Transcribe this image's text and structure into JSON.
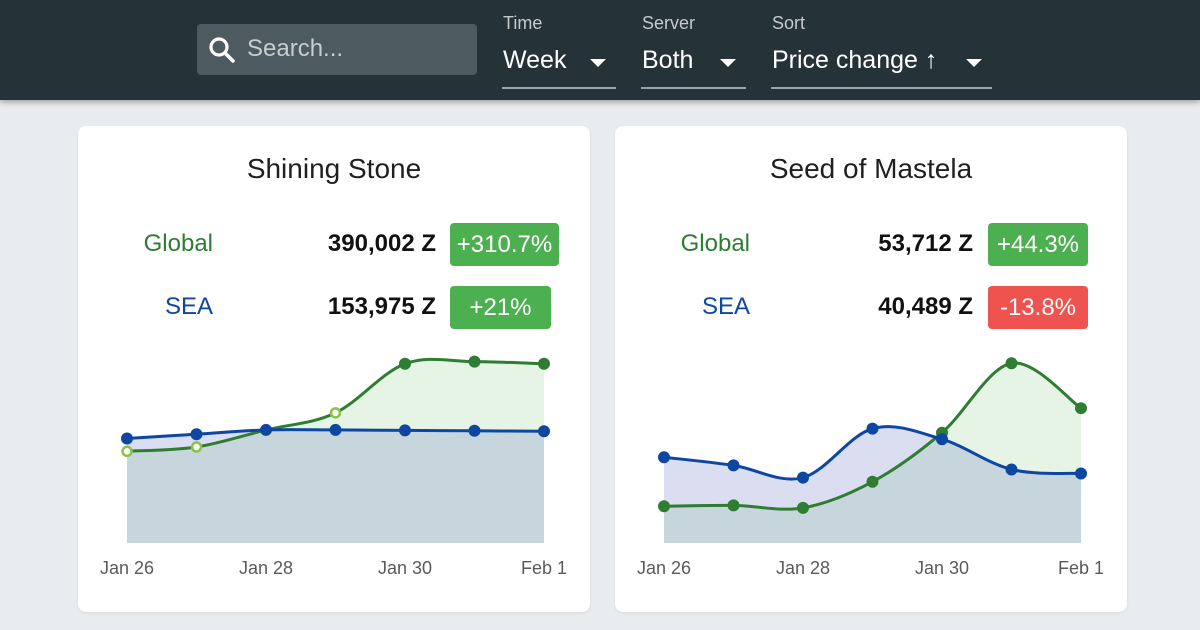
{
  "search": {
    "placeholder": "Search..."
  },
  "filters": [
    {
      "label": "Time",
      "value": "Week"
    },
    {
      "label": "Server",
      "value": "Both"
    },
    {
      "label": "Sort",
      "value": "Price change ↑"
    }
  ],
  "colors": {
    "global": "#2e7d32",
    "sea": "#0d47a1",
    "positive": "#4caf50",
    "negative": "#ef5350"
  },
  "cards": [
    {
      "title": "Shining Stone",
      "rows": [
        {
          "label": "Global",
          "price": "390,002 Z",
          "change": "+310.7%",
          "trend": "positive"
        },
        {
          "label": "SEA",
          "price": "153,975 Z",
          "change": "+21%",
          "trend": "positive"
        }
      ]
    },
    {
      "title": "Seed of Mastela",
      "rows": [
        {
          "label": "Global",
          "price": "53,712 Z",
          "change": "+44.3%",
          "trend": "positive"
        },
        {
          "label": "SEA",
          "price": "40,489 Z",
          "change": "-13.8%",
          "trend": "negative"
        }
      ]
    }
  ],
  "chart_data": [
    {
      "type": "area",
      "x": [
        "Jan 26",
        "Jan 27",
        "Jan 28",
        "Jan 29",
        "Jan 30",
        "Jan 31",
        "Feb 1"
      ],
      "tick_labels": [
        "Jan 26",
        "Jan 28",
        "Jan 30",
        "Feb 1"
      ],
      "series": [
        {
          "name": "Global",
          "values": [
            3.15,
            3.25,
            3.65,
            4.05,
            5.2,
            5.25,
            5.2
          ],
          "hollow_points": [
            0,
            1,
            2,
            3
          ]
        },
        {
          "name": "SEA",
          "values": [
            3.45,
            3.55,
            3.65,
            3.65,
            3.64,
            3.63,
            3.62
          ]
        }
      ],
      "ylim": [
        1,
        5.5
      ],
      "legend": "none"
    },
    {
      "type": "area",
      "x": [
        "Jan 26",
        "Jan 27",
        "Jan 28",
        "Jan 29",
        "Jan 30",
        "Jan 31",
        "Feb 1"
      ],
      "tick_labels": [
        "Jan 26",
        "Jan 28",
        "Jan 30",
        "Feb 1"
      ],
      "series": [
        {
          "name": "Global",
          "values": [
            3.4,
            3.41,
            3.38,
            3.7,
            4.3,
            5.15,
            4.6
          ]
        },
        {
          "name": "SEA",
          "values": [
            4.0,
            3.9,
            3.75,
            4.35,
            4.22,
            3.85,
            3.8
          ]
        }
      ],
      "ylim": [
        2.95,
        5.3
      ],
      "legend": "none"
    }
  ]
}
